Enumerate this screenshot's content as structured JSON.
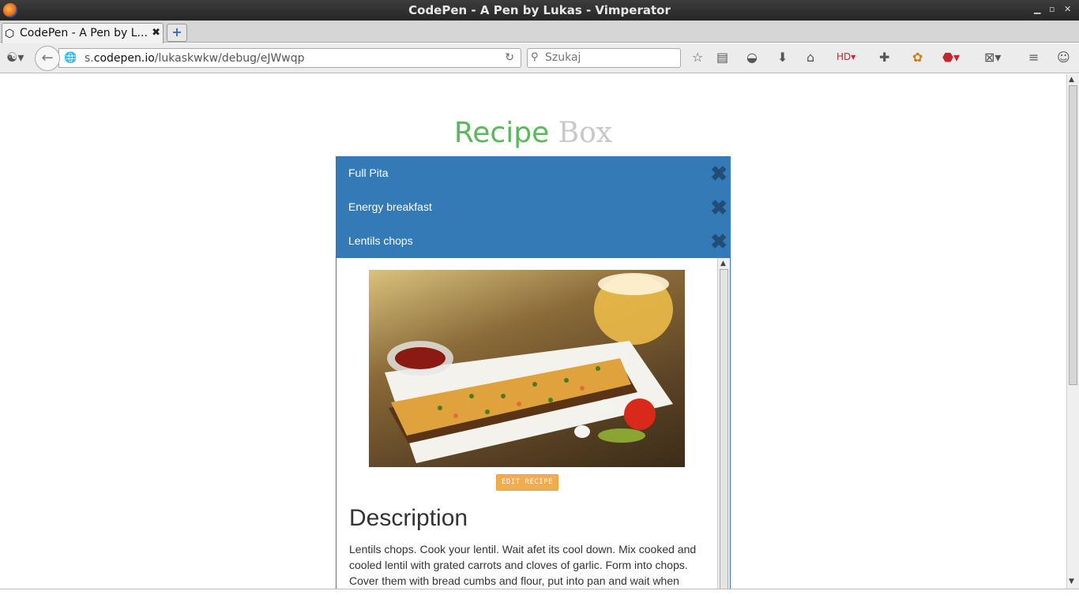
{
  "window": {
    "title": "CodePen - A Pen by Lukas - Vimperator"
  },
  "tabs": [
    {
      "label": "CodePen - A Pen by L..."
    }
  ],
  "navbar": {
    "url_prefix": "s.",
    "url_domain": "codepen.io",
    "url_path": "/lukaskwkw/debug/eJWwqp",
    "search_placeholder": "Szukaj"
  },
  "page": {
    "title_word1": "Recipe",
    "title_word2": "Box",
    "recipes": [
      {
        "label": "Full Pita"
      },
      {
        "label": "Energy breakfast"
      },
      {
        "label": "Lentils chops"
      }
    ],
    "expanded": {
      "edit_button": "EDIT RECIPE",
      "heading": "Description",
      "text": "Lentils chops. Cook your lentil. Wait afet its cool down. Mix cooked and cooled lentil with grated carrots and cloves of garlic. Form into chops. Cover them with bread cumbs and flour, put into pan and wait when"
    }
  },
  "colors": {
    "accent_green": "#5cb85c",
    "recipe_blue": "#337ab7",
    "warning_orange": "#f0ad4e"
  }
}
